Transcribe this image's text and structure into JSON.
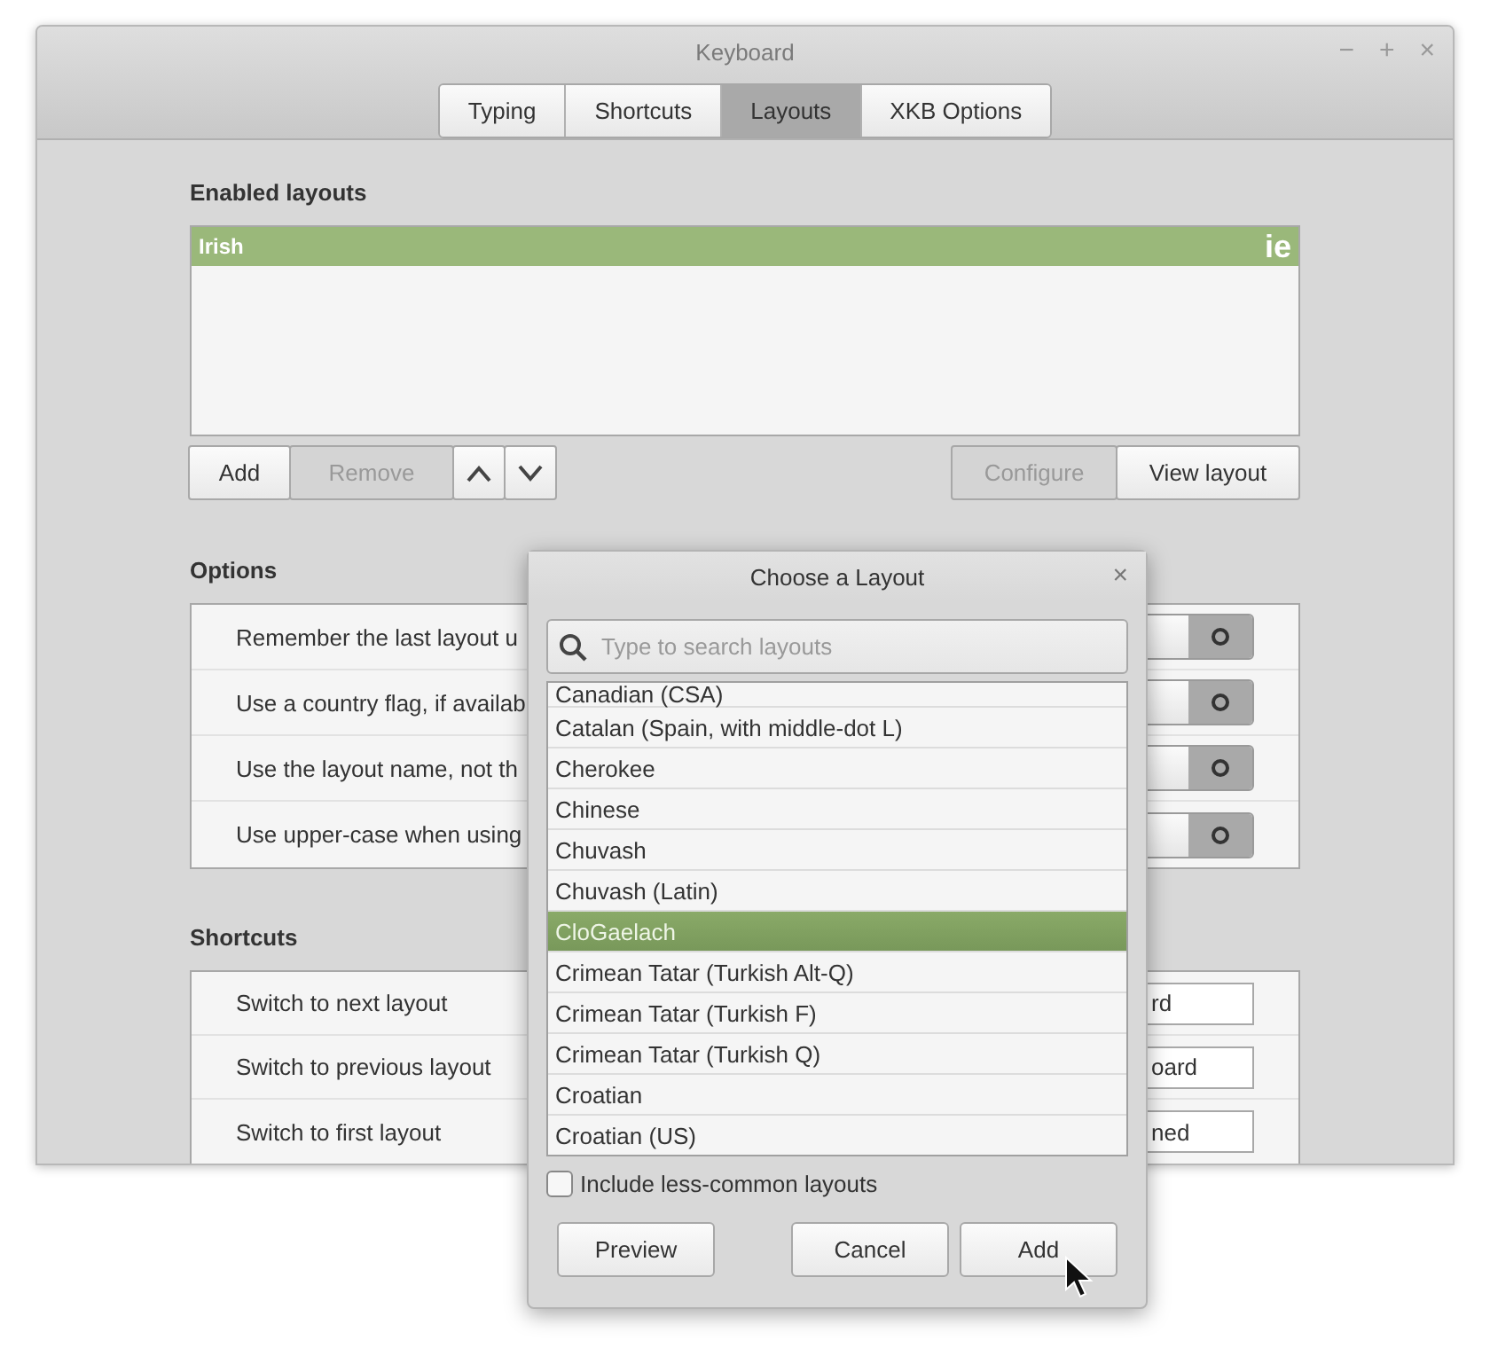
{
  "window": {
    "title": "Keyboard",
    "controls": [
      "−",
      "+",
      "×"
    ]
  },
  "tabs": [
    {
      "label": "Typing",
      "selected": false
    },
    {
      "label": "Shortcuts",
      "selected": false
    },
    {
      "label": "Layouts",
      "selected": true
    },
    {
      "label": "XKB Options",
      "selected": false
    }
  ],
  "enabled_layouts": {
    "heading": "Enabled layouts",
    "items": [
      {
        "name": "Irish",
        "code": "ie",
        "selected": true
      }
    ]
  },
  "layout_buttons": [
    {
      "label": "Add",
      "disabled": false
    },
    {
      "label": "Remove",
      "disabled": true
    }
  ],
  "move_buttons": [
    {
      "kind": "up",
      "disabled": false
    },
    {
      "kind": "down",
      "disabled": false
    }
  ],
  "right_buttons": [
    {
      "label": "Configure",
      "disabled": true
    },
    {
      "label": "View layout",
      "disabled": false
    }
  ],
  "options": {
    "heading": "Options",
    "rows": [
      {
        "label": "Remember the last layout u",
        "on": false
      },
      {
        "label": "Use a country flag, if availab",
        "on": false
      },
      {
        "label": "Use the layout name, not th",
        "on": false
      },
      {
        "label": "Use upper-case when using",
        "on": false
      }
    ]
  },
  "shortcuts": {
    "heading": "Shortcuts",
    "rows": [
      {
        "label": "Switch to next layout",
        "value": "rd"
      },
      {
        "label": "Switch to previous layout",
        "value": "oard"
      },
      {
        "label": "Switch to first layout",
        "value": "ned"
      }
    ]
  },
  "dialog": {
    "title": "Choose a Layout",
    "close": "×",
    "search": {
      "placeholder": "Type to search layouts"
    },
    "items": [
      {
        "name": "Canadian (CSA)",
        "selected": false
      },
      {
        "name": "Catalan (Spain, with middle-dot L)",
        "selected": false
      },
      {
        "name": "Cherokee",
        "selected": false
      },
      {
        "name": "Chinese",
        "selected": false
      },
      {
        "name": "Chuvash",
        "selected": false
      },
      {
        "name": "Chuvash (Latin)",
        "selected": false
      },
      {
        "name": "CloGaelach",
        "selected": true
      },
      {
        "name": "Crimean Tatar (Turkish Alt-Q)",
        "selected": false
      },
      {
        "name": "Crimean Tatar (Turkish F)",
        "selected": false
      },
      {
        "name": "Crimean Tatar (Turkish Q)",
        "selected": false
      },
      {
        "name": "Croatian",
        "selected": false
      },
      {
        "name": "Croatian (US)",
        "selected": false
      }
    ],
    "include_less_common": {
      "label": "Include less-common layouts",
      "checked": false
    },
    "buttons": [
      "Preview",
      "Cancel",
      "Add"
    ]
  }
}
